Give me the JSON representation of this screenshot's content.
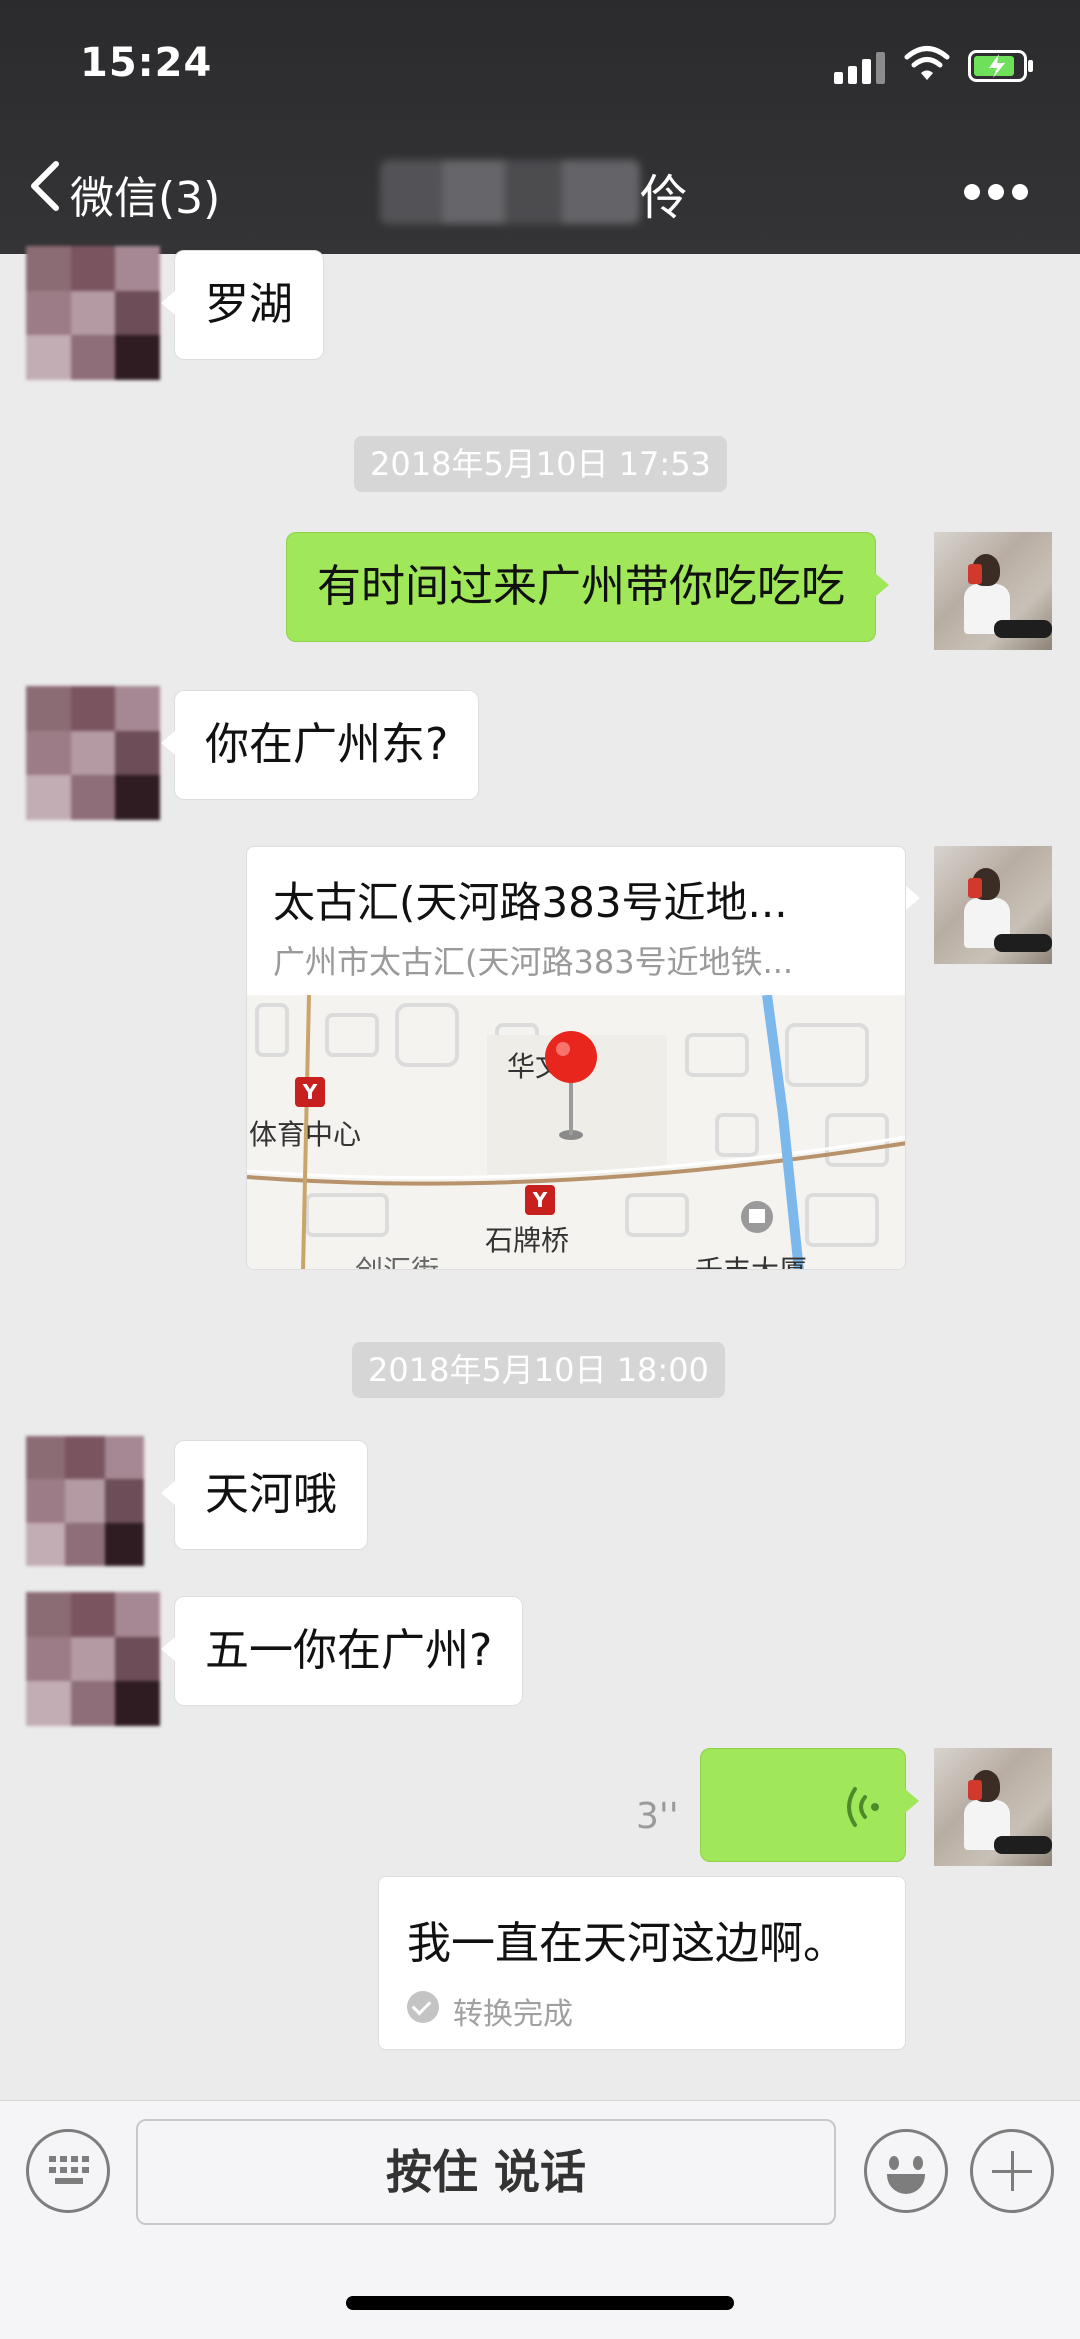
{
  "status_bar": {
    "time": "15:24"
  },
  "header": {
    "back_label": "微信(3)",
    "title_visible_char": "伶"
  },
  "messages": {
    "m1": "罗湖",
    "t1": "2018年5月10日 17:53",
    "m2": "有时间过来广州带你吃吃吃",
    "m3": "你在广州东?",
    "location": {
      "title": "太古汇(天河路383号近地...",
      "address": "广州市太古汇(天河路383号近地铁...",
      "map_labels": {
        "sports_center": "体育中心",
        "shipaiqiao": "石牌桥",
        "huawen": "华文",
        "chuanghui": "创汇街",
        "qianfeng": "千丰大厦"
      }
    },
    "t2": "2018年5月10日 18:00",
    "m4": "天河哦",
    "m5": "五一你在广州?",
    "voice": {
      "duration": "3''"
    },
    "transcript": {
      "text": "我一直在天河这边啊。",
      "status": "转换完成"
    }
  },
  "input_bar": {
    "talk_label": "按住 说话"
  },
  "colors": {
    "header_bg": "#2e2e30",
    "sent_bubble": "#a0e75a",
    "chat_bg": "#ebebeb"
  }
}
